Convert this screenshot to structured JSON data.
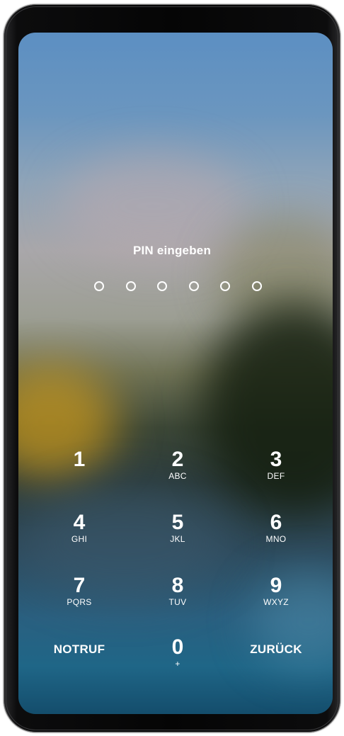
{
  "lockscreen": {
    "prompt": "PIN eingeben",
    "pin_length_slots": 6,
    "entered_digits": 0
  },
  "keypad": {
    "keys": [
      {
        "digit": "1",
        "letters": ""
      },
      {
        "digit": "2",
        "letters": "ABC"
      },
      {
        "digit": "3",
        "letters": "DEF"
      },
      {
        "digit": "4",
        "letters": "GHI"
      },
      {
        "digit": "5",
        "letters": "JKL"
      },
      {
        "digit": "6",
        "letters": "MNO"
      },
      {
        "digit": "7",
        "letters": "PQRS"
      },
      {
        "digit": "8",
        "letters": "TUV"
      },
      {
        "digit": "9",
        "letters": "WXYZ"
      },
      {
        "digit": "0",
        "letters": "+"
      }
    ],
    "emergency_label": "NOTRUF",
    "back_label": "ZURÜCK"
  },
  "colors": {
    "text": "#ffffff"
  }
}
